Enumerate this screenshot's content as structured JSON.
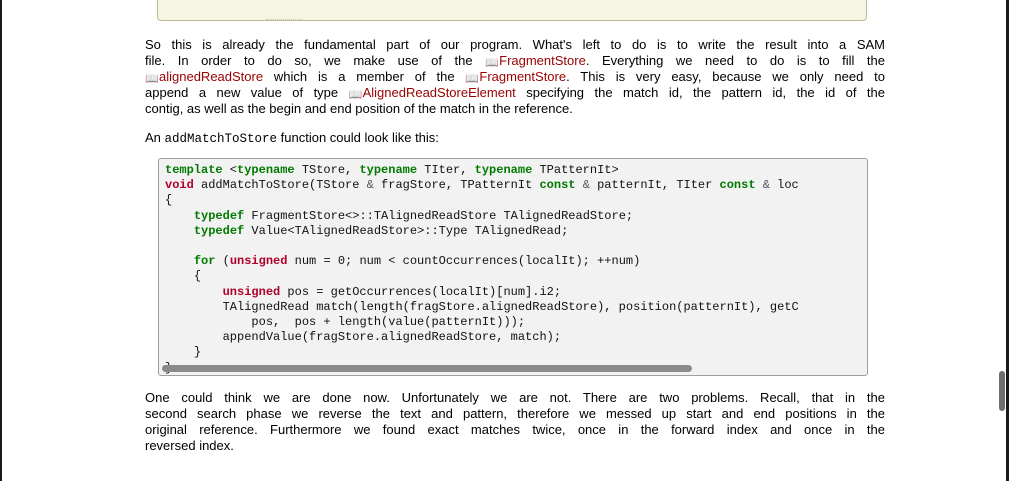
{
  "para1": {
    "line1": "So this is already the fundamental part of our program. What's left to do is to write the result into a SAM",
    "line2_pre": "file. In order to do so, we make use of the ",
    "link_fragmentstore": "FragmentStore",
    "line2_post": ". Everything we need to do is to fill the",
    "link_alignedreadstore": "alignedReadStore",
    "line3_mid": " which is a member of the ",
    "line3_post": ". This is very easy, because we only need to",
    "line4_pre": "append a new value of type ",
    "link_alignedreadstoreelement": "AlignedReadStoreElement",
    "line4_post": " specifying the match id, the pattern id, the id of the",
    "line5": "contig, as well as the begin and end position of the match in the reference."
  },
  "para2": {
    "pre": "An ",
    "code": "addMatchToStore",
    "post": " function could look like this:"
  },
  "code": {
    "l1_template": "template",
    "l1_a": " <",
    "l1_typename": "typename",
    "l1_b": " TStore, ",
    "l1_c": " TIter, ",
    "l1_d": " TPatternIt>",
    "l2_void": "void",
    "l2_a": " addMatchToStore(TStore ",
    "l2_amp": "&",
    "l2_b": " fragStore, TPatternIt ",
    "l2_const": "const",
    "l2_c": " patternIt, TIter ",
    "l2_d": " loc",
    "l3": "{",
    "l4_typedef": "typedef",
    "l4_a": " FragmentStore<>::TAlignedReadStore TAlignedReadStore;",
    "l5_a": " Value<TAlignedReadStore>::Type TAlignedRead;",
    "l7_for": "for",
    "l7_a": " (",
    "l7_unsigned": "unsigned",
    "l7_b": " num = 0; num < countOccurrences(localIt); ++num)",
    "l8": "{",
    "l9_a": " pos = getOccurrences(localIt)[num].i2;",
    "l10": "TAlignedRead match(length(fragStore.alignedReadStore), position(patternIt), getC",
    "l11": "pos,  pos + length(value(patternIt)));",
    "l12": "appendValue(fragStore.alignedReadStore, match);",
    "l13": "}",
    "l14": "}"
  },
  "para3": {
    "line1": "One could think we are done now. Unfortunately we are not. There are two problems. Recall, that in the",
    "line2": "second search phase we reverse the text and pattern, therefore we messed up start and end positions in the",
    "line3": "original reference. Furthermore we found exact matches twice, once in the forward index and once in the",
    "line4": "reversed index."
  }
}
